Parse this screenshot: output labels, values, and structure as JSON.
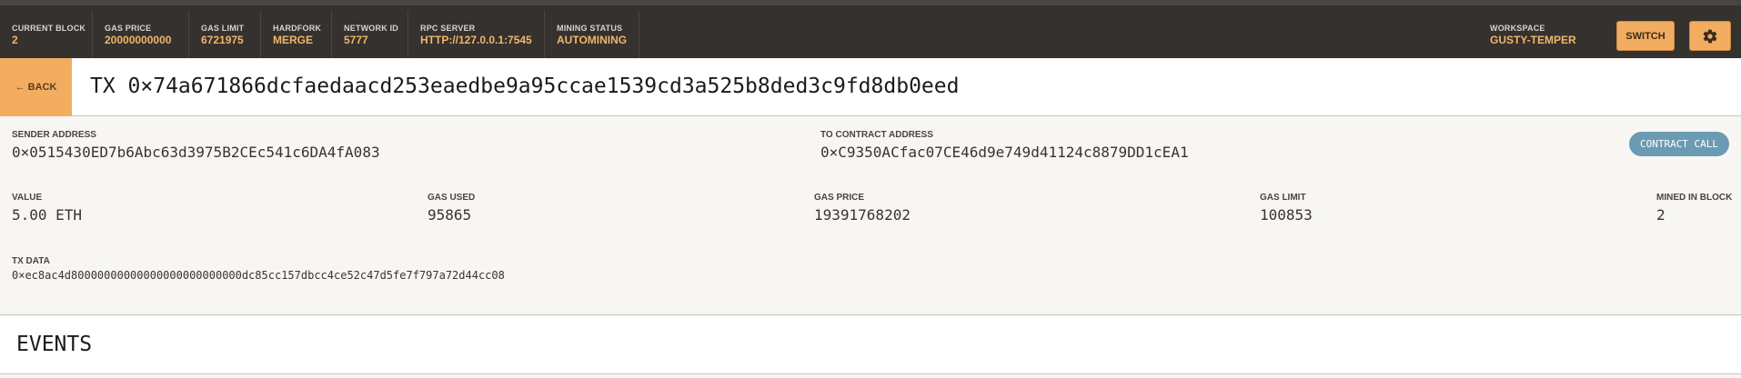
{
  "topbar": {
    "stats": [
      {
        "label": "CURRENT BLOCK",
        "value": "2"
      },
      {
        "label": "GAS PRICE",
        "value": "20000000000"
      },
      {
        "label": "GAS LIMIT",
        "value": "6721975"
      },
      {
        "label": "HARDFORK",
        "value": "MERGE"
      },
      {
        "label": "NETWORK ID",
        "value": "5777"
      },
      {
        "label": "RPC SERVER",
        "value": "HTTP://127.0.0.1:7545"
      },
      {
        "label": "MINING STATUS",
        "value": "AUTOMINING"
      }
    ],
    "workspace_label": "WORKSPACE",
    "workspace_value": "GUSTY-TEMPER",
    "switch_label": "SWITCH",
    "settings_icon": "gear-icon"
  },
  "header": {
    "back_label": "← BACK",
    "title": "TX 0×74a671866dcfaedaacd253eaedbe9a95ccae1539cd3a525b8ded3c9fd8db0eed"
  },
  "details": {
    "sender_label": "SENDER ADDRESS",
    "sender_value": "0×0515430ED7b6Abc63d3975B2CEc541c6DA4fA083",
    "to_label": "TO CONTRACT ADDRESS",
    "to_value": "0×C9350ACfac07CE46d9e749d41124c8879DD1cEA1",
    "badge": "CONTRACT CALL",
    "value_label": "VALUE",
    "value_value": "5.00 ETH",
    "gas_used_label": "GAS USED",
    "gas_used_value": "95865",
    "gas_price_label": "GAS PRICE",
    "gas_price_value": "19391768202",
    "gas_limit_label": "GAS LIMIT",
    "gas_limit_value": "100853",
    "mined_label": "MINED IN BLOCK",
    "mined_value": "2",
    "txdata_label": "TX DATA",
    "txdata_value": "0×ec8ac4d80000000000000000000000000dc85cc157dbcc4ce52c47d5fe7f797a72d44cc08"
  },
  "events": {
    "title": "EVENTS"
  },
  "colors": {
    "topbar_bg": "#35312e",
    "accent": "#f2ad60",
    "stat_value": "#f0b66b",
    "badge_bg": "#6b9bb3"
  }
}
